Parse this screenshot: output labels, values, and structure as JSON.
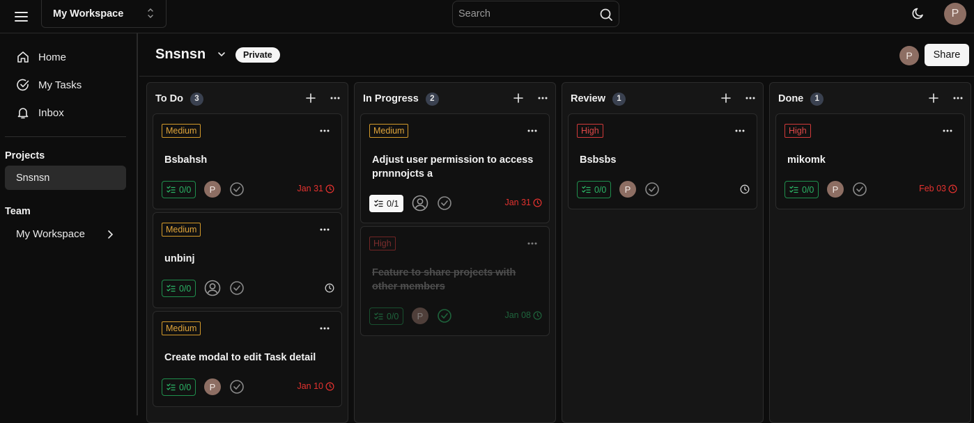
{
  "topbar": {
    "workspace_selector": "My Workspace",
    "search_placeholder": "Search",
    "user_initial": "P"
  },
  "sidebar": {
    "nav": [
      {
        "label": "Home",
        "icon": "home-icon"
      },
      {
        "label": "My Tasks",
        "icon": "check-circle-icon"
      },
      {
        "label": "Inbox",
        "icon": "bell-icon"
      }
    ],
    "projects_title": "Projects",
    "projects": [
      "Snsnsn"
    ],
    "team_title": "Team",
    "team_item": "My Workspace"
  },
  "board": {
    "title": "Snsnsn",
    "visibility": "Private",
    "member_initial": "P",
    "share_label": "Share"
  },
  "colors": {
    "medium": "#e0a53a",
    "high": "#e04848",
    "subtask_green": "#2bb566",
    "overdue_red": "#e5322f",
    "avatar": "#8d6e63"
  },
  "columns": [
    {
      "title": "To Do",
      "count": "3",
      "cards": [
        {
          "priority": "Medium",
          "title": "Bsbahsh",
          "subtasks": "0/0",
          "assignee": "P",
          "due": "Jan 31"
        },
        {
          "priority": "Medium",
          "title": "unbinj",
          "subtasks": "0/0",
          "assignee": "",
          "due": ""
        },
        {
          "priority": "Medium",
          "title": "Create modal to edit Task detail",
          "subtasks": "0/0",
          "assignee": "P",
          "due": "Jan 10"
        }
      ]
    },
    {
      "title": "In Progress",
      "count": "2",
      "cards": [
        {
          "priority": "Medium",
          "title": "Adjust user permission to access prnnnojcts a",
          "subtasks": "0/1",
          "assignee": "",
          "due": "Jan 31"
        },
        {
          "priority": "High",
          "title": "Feature to share projects with other members",
          "subtasks": "0/0",
          "assignee": "P",
          "due": "Jan 08",
          "completed": true
        }
      ]
    },
    {
      "title": "Review",
      "count": "1",
      "cards": [
        {
          "priority": "High",
          "title": "Bsbsbs",
          "subtasks": "0/0",
          "assignee": "P",
          "due": ""
        }
      ]
    },
    {
      "title": "Done",
      "count": "1",
      "cards": [
        {
          "priority": "High",
          "title": "mikomk",
          "subtasks": "0/0",
          "assignee": "P",
          "due": "Feb 03"
        }
      ]
    }
  ]
}
